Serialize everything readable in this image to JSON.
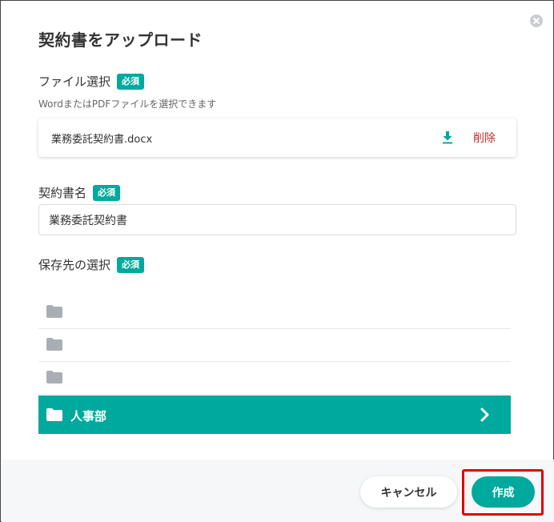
{
  "dialog": {
    "title": "契約書をアップロード",
    "close_icon": "close-circle-icon"
  },
  "file_section": {
    "label": "ファイル選択",
    "required_badge": "必須",
    "hint": "WordまたはPDFファイルを選択できます",
    "file_name": "業務委託契約書.docx",
    "download_icon": "download-icon",
    "delete_label": "削除"
  },
  "name_section": {
    "label": "契約書名",
    "required_badge": "必須",
    "value": "業務委託契約書"
  },
  "destination_section": {
    "label": "保存先の選択",
    "required_badge": "必須",
    "folders": [
      {
        "name": "",
        "selected": false
      },
      {
        "name": "",
        "selected": false
      },
      {
        "name": "",
        "selected": false
      },
      {
        "name": "人事部",
        "selected": true
      }
    ]
  },
  "footer": {
    "cancel_label": "キャンセル",
    "create_label": "作成"
  },
  "colors": {
    "accent": "#00a99d",
    "delete": "#c62828",
    "highlight": "#e00000"
  }
}
